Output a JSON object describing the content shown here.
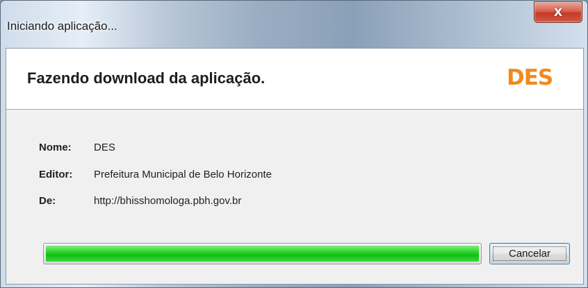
{
  "window": {
    "title": "Iniciando aplicação...",
    "close_icon": "close-icon",
    "close_glyph": "X"
  },
  "header": {
    "heading": "Fazendo download da aplicação.",
    "logo_text": "DES",
    "logo_color": "#f08a1c"
  },
  "info": [
    {
      "label": "Nome:",
      "value": "DES"
    },
    {
      "label": "Editor:",
      "value": "Prefeitura Municipal de Belo Horizonte"
    },
    {
      "label": "De:",
      "value": "http://bhisshomologa.pbh.gov.br"
    }
  ],
  "progress": {
    "percent": 100,
    "color": "#1ccf1c"
  },
  "buttons": {
    "cancel_label": "Cancelar"
  }
}
